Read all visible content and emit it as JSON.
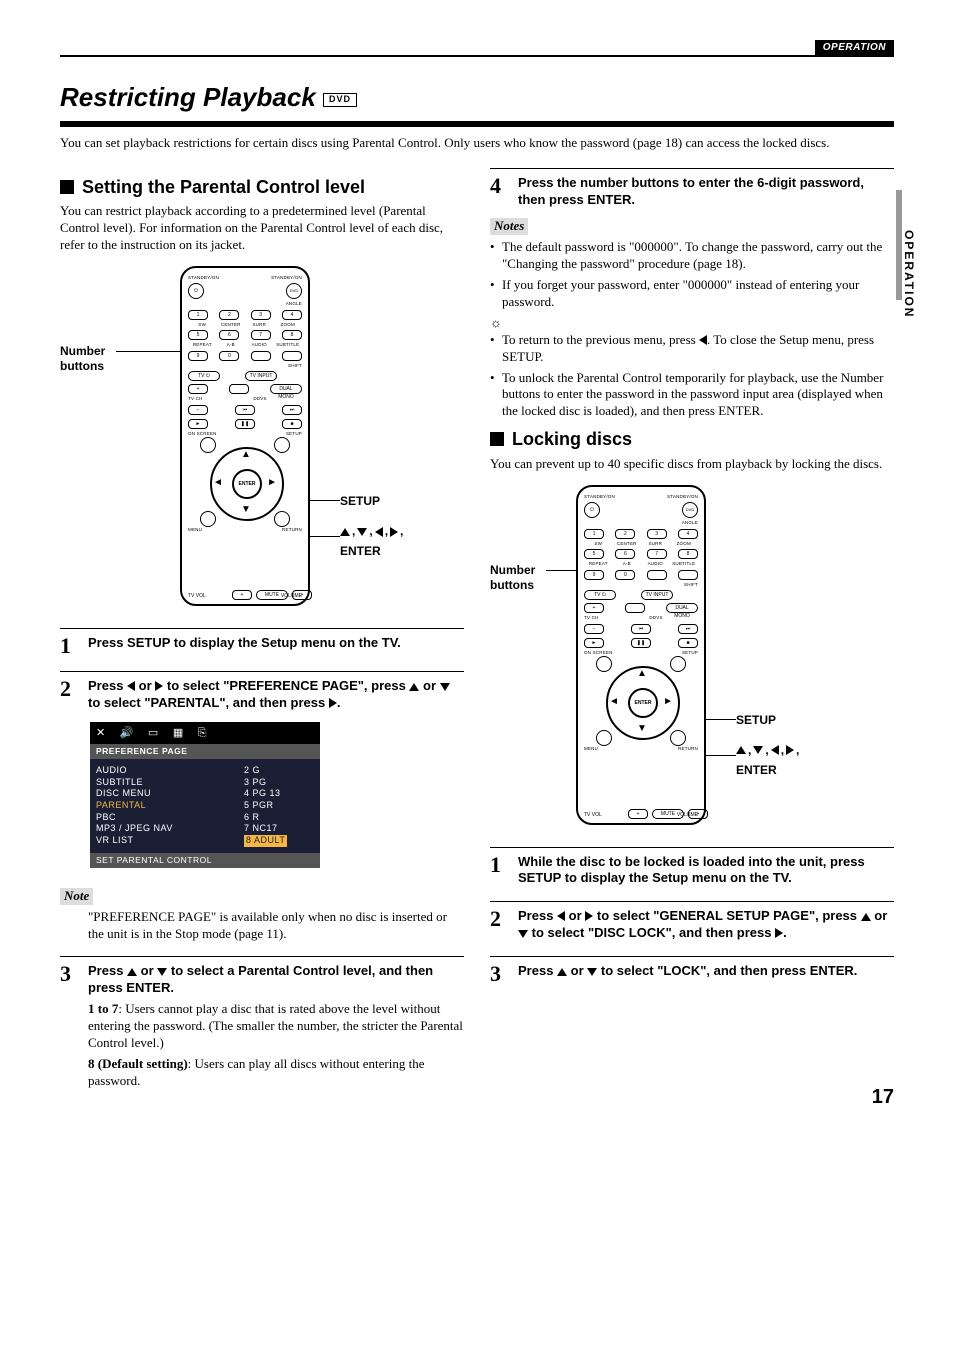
{
  "header": {
    "section": "OPERATION"
  },
  "side_tab": "OPERATION",
  "title": "Restricting Playback",
  "dvd_badge": "DVD",
  "intro": "You can set playback restrictions for certain discs using Parental Control. Only users who know the password (page 18) can access the locked discs.",
  "left": {
    "h2": "Setting the Parental Control level",
    "p1": "You can restrict playback according to a predetermined level (Parental Control level). For information on the Parental Control level of each disc, refer to the instruction on its jacket.",
    "remote_label_left": "Number buttons",
    "remote_label_setup": "SETUP",
    "remote_label_enter": "ENTER",
    "remote_dir_cluster_suffix": ",",
    "step1": {
      "n": "1",
      "t": "Press SETUP to display the Setup menu on the TV."
    },
    "step2": {
      "n": "2",
      "prefix": "Press ",
      "mid1": " or ",
      "mid2": " to select \"PREFERENCE PAGE\", press ",
      "mid3": " or ",
      "mid4": " to select \"PARENTAL\", and then press ",
      "suffix": "."
    },
    "osd": {
      "tab": "PREFERENCE  PAGE",
      "rows_left": [
        "AUDIO",
        "SUBTITLE",
        "DISC   MENU",
        "PARENTAL",
        "PBC",
        "MP3 / JPEG   NAV",
        "VR   LIST"
      ],
      "rows_right": [
        "2   G",
        "3   PG",
        "4   PG   13",
        "5   PGR",
        "6   R",
        "7   NC17",
        "8   ADULT"
      ],
      "highlight_left_idx": 3,
      "highlight_right_idx": 6,
      "footer": "SET   PARENTAL   CONTROL"
    },
    "note_head": "Note",
    "note_body": "\"PREFERENCE PAGE\" is available only when no disc is inserted or the unit is in the Stop mode (page 11).",
    "step3": {
      "n": "3",
      "prefix": "Press ",
      "mid1": " or ",
      "mid2": " to select a Parental Control level, and then press ENTER.",
      "b1_label": "1 to 7",
      "b1_text": ": Users cannot play a disc that is rated above the level without entering the password. (The smaller the number, the stricter the Parental Control level.)",
      "b2_label": "8 (Default setting)",
      "b2_text": ": Users can play all discs without entering the password."
    }
  },
  "right": {
    "step4": {
      "n": "4",
      "t": "Press the number buttons to enter the 6-digit password, then press ENTER."
    },
    "notes_head": "Notes",
    "note_b1": "The default password is \"000000\". To change the password, carry out the \"Changing the password\" procedure (page 18).",
    "note_b2": "If you forget your password, enter \"000000\" instead of entering your password.",
    "tip_b1_prefix": "To return to the previous menu, press ",
    "tip_b1_suffix": ". To close the Setup menu, press SETUP.",
    "tip_b2": "To unlock the Parental Control temporarily for playback, use the Number buttons to enter the password in the password input area (displayed when the locked disc is loaded), and then press ENTER.",
    "h2": "Locking discs",
    "p1": "You can prevent up to 40 specific discs from playback by locking the discs.",
    "remote_label_left": "Number buttons",
    "remote_label_setup": "SETUP",
    "remote_label_enter": "ENTER",
    "step1": {
      "n": "1",
      "t": "While the disc to be locked is loaded into the unit, press SETUP to display the Setup menu on the TV."
    },
    "step2": {
      "n": "2",
      "prefix": "Press ",
      "mid1": " or ",
      "mid2": " to select \"GENERAL SETUP PAGE\", press ",
      "mid3": " or ",
      "mid4": " to select \"DISC LOCK\", and then press ",
      "suffix": "."
    },
    "step3": {
      "n": "3",
      "prefix": "Press ",
      "mid1": " or ",
      "mid2": " to select \"LOCK\", and then press ENTER."
    }
  },
  "remote": {
    "standby_l": "STANDBY/ON",
    "standby_r": "STANDBY/ON",
    "dvd": "DVD",
    "angle": "ANGLE",
    "sw": "SW",
    "center": "CENTER",
    "surr": "SURR",
    "zoom": "ZOOM",
    "repeat": "REPEAT",
    "ab": "A-B",
    "audio": "AUDIO",
    "subtitle": "SUBTITLE",
    "shift": "SHIFT",
    "tv": "TV",
    "tvinput": "TV INPUT",
    "dualmono": "DUAL MONO",
    "tvch": "TV CH",
    "ddvs": "DDVS",
    "onscreen": "ON SCREEN",
    "setup": "SETUP",
    "menu": "MENU",
    "return": "RETURN",
    "enter": "ENTER",
    "tvvol": "TV VOL",
    "mute": "MUTE",
    "volume": "VOLUME"
  },
  "page_number": "17"
}
